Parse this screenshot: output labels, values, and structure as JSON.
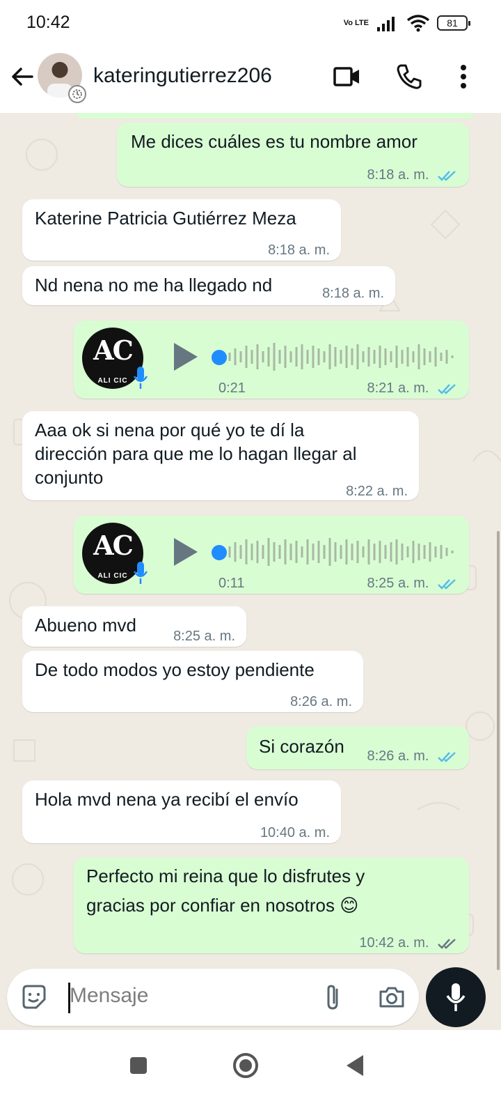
{
  "status_bar": {
    "time": "10:42",
    "network_label": "Vo LTE",
    "battery": "81"
  },
  "header": {
    "contact_name": "kateringutierrez206",
    "icons": [
      "back-arrow-icon",
      "video-call-icon",
      "phone-icon",
      "more-vertical-icon"
    ]
  },
  "messages": [
    {
      "dir": "out",
      "text": "Me dices cuáles es tu nombre amor",
      "time": "8:18 a. m.",
      "status": "read"
    },
    {
      "dir": "in",
      "text": "Katerine Patricia Gutiérrez Meza",
      "time": "8:18 a. m."
    },
    {
      "dir": "in",
      "text": "Nd nena no me ha llegado nd",
      "time": "8:18 a. m."
    },
    {
      "dir": "out",
      "type": "voice",
      "duration": "0:21",
      "time": "8:21 a. m.",
      "status": "read",
      "logo_text": "AC",
      "logo_brand": "ALI CIC"
    },
    {
      "dir": "in",
      "lines": [
        "Aaa ok si nena por qué yo te dí la",
        "dirección para que me lo hagan llegar al",
        "conjunto"
      ],
      "time": "8:22 a. m."
    },
    {
      "dir": "out",
      "type": "voice",
      "duration": "0:11",
      "time": "8:25 a. m.",
      "status": "read",
      "logo_text": "AC",
      "logo_brand": "ALI CIC"
    },
    {
      "dir": "in",
      "text": "Abueno mvd",
      "time": "8:25 a. m."
    },
    {
      "dir": "in",
      "text": "De todo modos yo estoy pendiente",
      "time": "8:26 a. m."
    },
    {
      "dir": "out",
      "text": "Si corazón",
      "time": "8:26 a. m.",
      "status": "read"
    },
    {
      "dir": "in",
      "text": "Hola mvd nena ya recibí el envío",
      "time": "10:40 a. m."
    },
    {
      "dir": "out",
      "lines": [
        "Perfecto mi reina que lo disfrutes y",
        "gracias por confiar en nosotros 😊"
      ],
      "time": "10:42 a. m.",
      "status": "delivered"
    }
  ],
  "composer": {
    "placeholder": "Mensaje"
  },
  "colors": {
    "outgoing": "#d9fdd3",
    "incoming": "#ffffff",
    "read_ticks": "#53bdeb",
    "voice_dot": "#1f8cff"
  }
}
